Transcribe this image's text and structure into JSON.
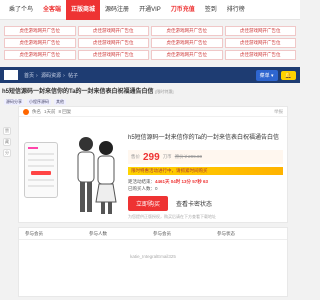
{
  "topnav": {
    "items": [
      {
        "label": "乘了个鸟"
      },
      {
        "label": "全客端"
      },
      {
        "label": "正版商城"
      },
      {
        "label": "源码注册"
      },
      {
        "label": "开通VIP"
      },
      {
        "label": "刀币充值"
      },
      {
        "label": "签到"
      },
      {
        "label": "排行榜"
      }
    ]
  },
  "ads": {
    "cell_text": "虎佳游戏网开广告位"
  },
  "bluebar": {
    "breadcrumb": [
      "首页",
      "源码资源",
      "帖子"
    ],
    "menu_label": "菜单",
    "bell_label": "通知"
  },
  "page": {
    "title": "h5短信源码一封来信你的Ta的一封来信表白祝福通告白信",
    "title_tag": "[限时特惠]"
  },
  "subinfo": {
    "items": [
      "源码分享",
      "小程序源码",
      "其他"
    ]
  },
  "card": {
    "author": "佚名",
    "time": "1天前",
    "views": "8 回复",
    "right": "举报"
  },
  "side_icons": [
    "赞",
    "藏",
    "分"
  ],
  "product": {
    "title": "h5短信源码一封来信你的Ta的一封来信表白祝福通告白信",
    "price_label": "售价",
    "price": "299",
    "price_unit": "刀币",
    "orig": "原价￥299.00",
    "promo": "限时特惠活动进行中，请抓紧时间购买",
    "countdown_label": "距活动结束：",
    "countdown": "4461天 04时 13分 57秒 63",
    "sales": "已购买人数：0",
    "buy_label": "立即购买",
    "status_label": "查看卡密状态",
    "note": "为您提供正版授权，购买后请在下方查看下载地址"
  },
  "table": {
    "headers": [
      "参与会员",
      "参与人数",
      "参与会员",
      "参与状态"
    ],
    "empty": "katie_IntegralEmail325"
  }
}
